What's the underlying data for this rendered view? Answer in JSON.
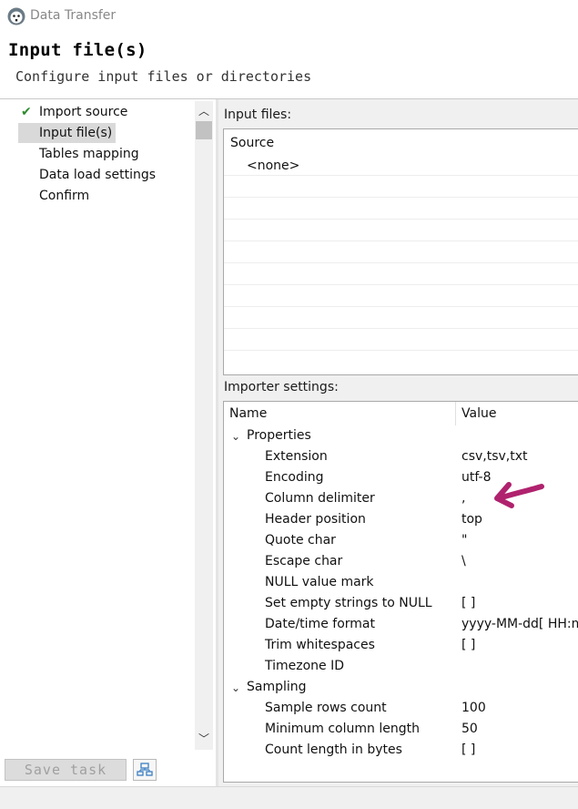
{
  "window": {
    "title": "Data Transfer",
    "icon": "dbeaver-beaver-icon"
  },
  "page": {
    "title": "Input file(s)",
    "subtitle": "Configure input files or directories"
  },
  "nav": {
    "items": [
      {
        "label": "Import source",
        "done": true,
        "selected": false
      },
      {
        "label": "Input file(s)",
        "done": false,
        "selected": true
      },
      {
        "label": "Tables mapping",
        "done": false,
        "selected": false
      },
      {
        "label": "Data load settings",
        "done": false,
        "selected": false
      },
      {
        "label": "Confirm",
        "done": false,
        "selected": false
      }
    ]
  },
  "buttons": {
    "save_task": "Save task"
  },
  "input_files": {
    "label": "Input files:",
    "column": "Source",
    "rows": [
      "<none>"
    ]
  },
  "importer_settings": {
    "label": "Importer settings:",
    "columns": {
      "name": "Name",
      "value": "Value"
    },
    "groups": [
      {
        "name": "Properties",
        "props": [
          {
            "name": "Extension",
            "value": "csv,tsv,txt"
          },
          {
            "name": "Encoding",
            "value": "utf-8"
          },
          {
            "name": "Column delimiter",
            "value": ","
          },
          {
            "name": "Header position",
            "value": "top"
          },
          {
            "name": "Quote char",
            "value": "\""
          },
          {
            "name": "Escape char",
            "value": "\\"
          },
          {
            "name": "NULL value mark",
            "value": ""
          },
          {
            "name": "Set empty strings to NULL",
            "value": "[ ]"
          },
          {
            "name": "Date/time format",
            "value": "yyyy-MM-dd[ HH:m"
          },
          {
            "name": "Trim whitespaces",
            "value": "[ ]"
          },
          {
            "name": "Timezone ID",
            "value": ""
          }
        ]
      },
      {
        "name": "Sampling",
        "props": [
          {
            "name": "Sample rows count",
            "value": "100"
          },
          {
            "name": "Minimum column length",
            "value": "50"
          },
          {
            "name": "Count length in bytes",
            "value": "[ ]"
          }
        ]
      }
    ]
  },
  "annotation": {
    "arrow_color": "#b0226e"
  }
}
